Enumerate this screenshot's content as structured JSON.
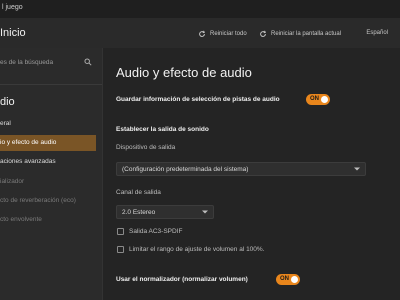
{
  "window": {
    "title": "l juego"
  },
  "header": {
    "home_label": "Inicio",
    "reset_all_label": "Reiniciar todo",
    "reset_screen_label": "Reiniciar la pantalla actual",
    "language_label": "Español"
  },
  "sidebar": {
    "search_placeholder": "es de la búsqueda",
    "section_title": "dio",
    "items": [
      {
        "label": "eral",
        "state": "normal"
      },
      {
        "label": "io y efecto de audio",
        "state": "selected"
      },
      {
        "label": "aciones avanzadas",
        "state": "normal"
      },
      {
        "label": "ializador",
        "state": "disabled"
      },
      {
        "label": "cto de reverberación (eco)",
        "state": "disabled"
      },
      {
        "label": "cto envolvente",
        "state": "disabled"
      }
    ]
  },
  "main": {
    "title": "Audio y efecto de audio",
    "save_track_label": "Guardar información de selección de pistas de audio",
    "save_track_toggle": "ON",
    "output_section_title": "Establecer la salida de sonido",
    "output_device_label": "Dispositivo de salida",
    "output_device_value": "(Configuración predeterminada del sistema)",
    "output_channel_label": "Canal de salida",
    "output_channel_value": "2.0 Estereo",
    "ac3_label": "Salida AC3-SPDIF",
    "limit_volume_label": "Limitar el rango de ajuste de volumen al 100%.",
    "normalizer_label": "Usar el normalizador (normalizar volumen)",
    "normalizer_toggle": "ON"
  },
  "colors": {
    "accent": "#e9861c",
    "selected_bg": "#7a5526",
    "background": "#242424"
  }
}
